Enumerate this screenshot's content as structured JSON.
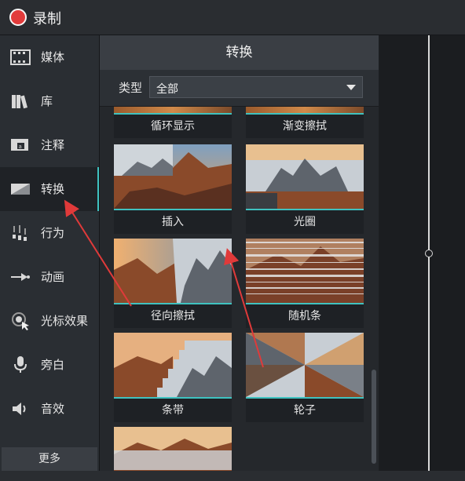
{
  "header": {
    "record_label": "录制"
  },
  "sidebar": {
    "items": [
      {
        "label": "媒体",
        "icon": "film-icon"
      },
      {
        "label": "库",
        "icon": "library-icon"
      },
      {
        "label": "注释",
        "icon": "annotation-icon"
      },
      {
        "label": "转换",
        "icon": "transition-icon",
        "active": true
      },
      {
        "label": "行为",
        "icon": "behavior-icon"
      },
      {
        "label": "动画",
        "icon": "animation-icon"
      },
      {
        "label": "光标效果",
        "icon": "cursor-effect-icon"
      },
      {
        "label": "旁白",
        "icon": "microphone-icon"
      },
      {
        "label": "音效",
        "icon": "speaker-icon"
      }
    ],
    "more_label": "更多"
  },
  "panel": {
    "title": "转换",
    "filter": {
      "label": "类型",
      "value": "全部"
    },
    "tiles": [
      {
        "label": "循环显示"
      },
      {
        "label": "渐变擦拭"
      },
      {
        "label": "插入"
      },
      {
        "label": "光圈"
      },
      {
        "label": "径向擦拭"
      },
      {
        "label": "随机条"
      },
      {
        "label": "条带"
      },
      {
        "label": "轮子"
      }
    ]
  },
  "colors": {
    "accent": "#3fc2c0",
    "record": "#e23b3b",
    "arrow": "#e03a3a"
  }
}
